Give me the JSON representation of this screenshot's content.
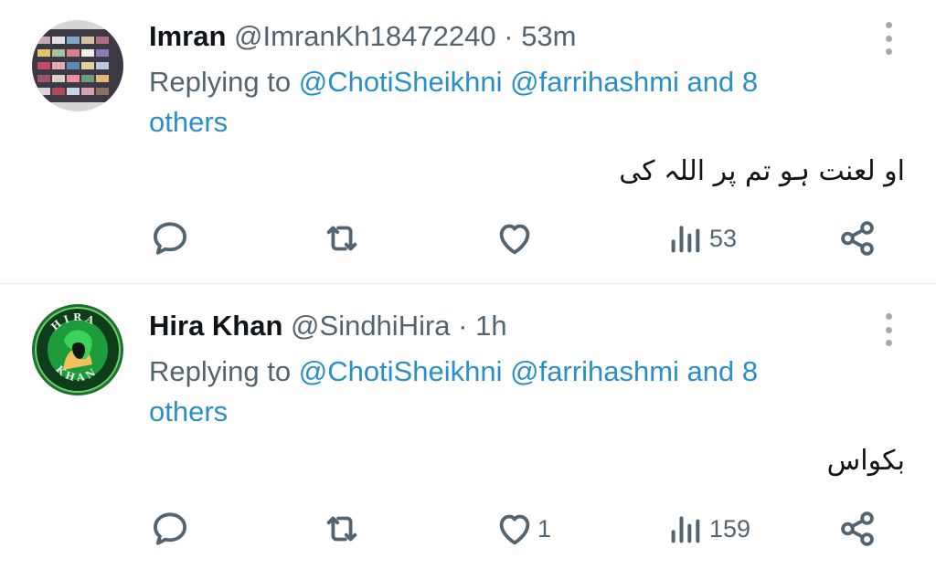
{
  "colors": {
    "accent": "#2a8fc9",
    "muted": "#536471",
    "icon": "#536471"
  },
  "tweets": [
    {
      "name": "Imran",
      "handle": "@ImranKh18472240",
      "separator": "·",
      "time": "53m",
      "replying_prefix": "Replying to ",
      "mention_1": "@ChotiSheikhni",
      "mention_2": "@farrihashmi",
      "mention_suffix": "and 8 others",
      "body": "او لعنت ہو تم پر اللہ کی",
      "replies": "",
      "retweets": "",
      "likes": "",
      "views": "53"
    },
    {
      "name": "Hira Khan",
      "handle": "@SindhiHira",
      "separator": "·",
      "time": "1h",
      "replying_prefix": "Replying to ",
      "mention_1": "@ChotiSheikhni",
      "mention_2": "@farrihashmi",
      "mention_suffix": "and 8 others",
      "body": "بکواس",
      "replies": "",
      "retweets": "",
      "likes": "1",
      "views": "159",
      "avatar_text": "HIRA KHAN"
    }
  ],
  "icons": [
    "reply-icon",
    "retweet-icon",
    "like-icon",
    "views-icon",
    "share-icon",
    "more-icon"
  ]
}
